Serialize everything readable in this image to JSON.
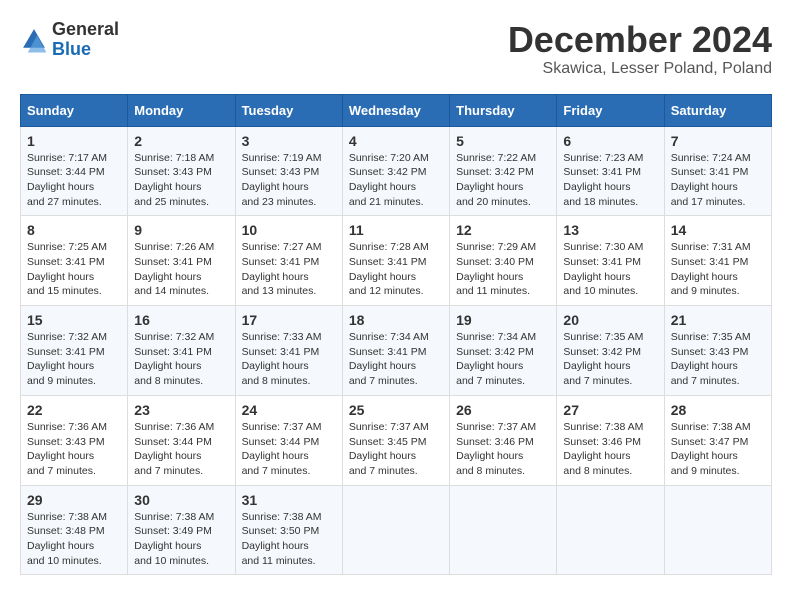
{
  "header": {
    "logo_line1": "General",
    "logo_line2": "Blue",
    "month": "December 2024",
    "location": "Skawica, Lesser Poland, Poland"
  },
  "days_of_week": [
    "Sunday",
    "Monday",
    "Tuesday",
    "Wednesday",
    "Thursday",
    "Friday",
    "Saturday"
  ],
  "weeks": [
    [
      {
        "day": 1,
        "sunrise": "7:17 AM",
        "sunset": "3:44 PM",
        "daylight": "8 hours and 27 minutes."
      },
      {
        "day": 2,
        "sunrise": "7:18 AM",
        "sunset": "3:43 PM",
        "daylight": "8 hours and 25 minutes."
      },
      {
        "day": 3,
        "sunrise": "7:19 AM",
        "sunset": "3:43 PM",
        "daylight": "8 hours and 23 minutes."
      },
      {
        "day": 4,
        "sunrise": "7:20 AM",
        "sunset": "3:42 PM",
        "daylight": "8 hours and 21 minutes."
      },
      {
        "day": 5,
        "sunrise": "7:22 AM",
        "sunset": "3:42 PM",
        "daylight": "8 hours and 20 minutes."
      },
      {
        "day": 6,
        "sunrise": "7:23 AM",
        "sunset": "3:41 PM",
        "daylight": "8 hours and 18 minutes."
      },
      {
        "day": 7,
        "sunrise": "7:24 AM",
        "sunset": "3:41 PM",
        "daylight": "8 hours and 17 minutes."
      }
    ],
    [
      {
        "day": 8,
        "sunrise": "7:25 AM",
        "sunset": "3:41 PM",
        "daylight": "8 hours and 15 minutes."
      },
      {
        "day": 9,
        "sunrise": "7:26 AM",
        "sunset": "3:41 PM",
        "daylight": "8 hours and 14 minutes."
      },
      {
        "day": 10,
        "sunrise": "7:27 AM",
        "sunset": "3:41 PM",
        "daylight": "8 hours and 13 minutes."
      },
      {
        "day": 11,
        "sunrise": "7:28 AM",
        "sunset": "3:41 PM",
        "daylight": "8 hours and 12 minutes."
      },
      {
        "day": 12,
        "sunrise": "7:29 AM",
        "sunset": "3:40 PM",
        "daylight": "8 hours and 11 minutes."
      },
      {
        "day": 13,
        "sunrise": "7:30 AM",
        "sunset": "3:41 PM",
        "daylight": "8 hours and 10 minutes."
      },
      {
        "day": 14,
        "sunrise": "7:31 AM",
        "sunset": "3:41 PM",
        "daylight": "8 hours and 9 minutes."
      }
    ],
    [
      {
        "day": 15,
        "sunrise": "7:32 AM",
        "sunset": "3:41 PM",
        "daylight": "8 hours and 9 minutes."
      },
      {
        "day": 16,
        "sunrise": "7:32 AM",
        "sunset": "3:41 PM",
        "daylight": "8 hours and 8 minutes."
      },
      {
        "day": 17,
        "sunrise": "7:33 AM",
        "sunset": "3:41 PM",
        "daylight": "8 hours and 8 minutes."
      },
      {
        "day": 18,
        "sunrise": "7:34 AM",
        "sunset": "3:41 PM",
        "daylight": "8 hours and 7 minutes."
      },
      {
        "day": 19,
        "sunrise": "7:34 AM",
        "sunset": "3:42 PM",
        "daylight": "8 hours and 7 minutes."
      },
      {
        "day": 20,
        "sunrise": "7:35 AM",
        "sunset": "3:42 PM",
        "daylight": "8 hours and 7 minutes."
      },
      {
        "day": 21,
        "sunrise": "7:35 AM",
        "sunset": "3:43 PM",
        "daylight": "8 hours and 7 minutes."
      }
    ],
    [
      {
        "day": 22,
        "sunrise": "7:36 AM",
        "sunset": "3:43 PM",
        "daylight": "8 hours and 7 minutes."
      },
      {
        "day": 23,
        "sunrise": "7:36 AM",
        "sunset": "3:44 PM",
        "daylight": "8 hours and 7 minutes."
      },
      {
        "day": 24,
        "sunrise": "7:37 AM",
        "sunset": "3:44 PM",
        "daylight": "8 hours and 7 minutes."
      },
      {
        "day": 25,
        "sunrise": "7:37 AM",
        "sunset": "3:45 PM",
        "daylight": "8 hours and 7 minutes."
      },
      {
        "day": 26,
        "sunrise": "7:37 AM",
        "sunset": "3:46 PM",
        "daylight": "8 hours and 8 minutes."
      },
      {
        "day": 27,
        "sunrise": "7:38 AM",
        "sunset": "3:46 PM",
        "daylight": "8 hours and 8 minutes."
      },
      {
        "day": 28,
        "sunrise": "7:38 AM",
        "sunset": "3:47 PM",
        "daylight": "8 hours and 9 minutes."
      }
    ],
    [
      {
        "day": 29,
        "sunrise": "7:38 AM",
        "sunset": "3:48 PM",
        "daylight": "8 hours and 10 minutes."
      },
      {
        "day": 30,
        "sunrise": "7:38 AM",
        "sunset": "3:49 PM",
        "daylight": "8 hours and 10 minutes."
      },
      {
        "day": 31,
        "sunrise": "7:38 AM",
        "sunset": "3:50 PM",
        "daylight": "8 hours and 11 minutes."
      },
      null,
      null,
      null,
      null
    ]
  ]
}
